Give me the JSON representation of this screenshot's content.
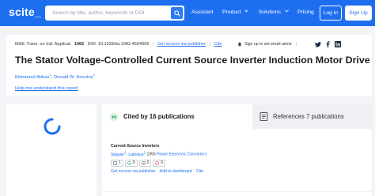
{
  "nav": {
    "logo": "scite_",
    "search_placeholder": "Search by title, author, keywords or DOI",
    "links": {
      "assistant": "Assistant",
      "product": "Product",
      "solutions": "Solutions",
      "pricing": "Pricing"
    },
    "login": "Log In",
    "signup": "Sign Up"
  },
  "paper": {
    "journal": "IEEE Trans. on Ind. Applicat.",
    "year": "1982",
    "doi": "DOI: 10.1109/tia.1982.4504065",
    "get_access": "Get access via publisher",
    "cite": "Cite",
    "alerts": "Sign up to set email alerts",
    "title": "The Stator Voltage-Controlled Current Source Inverter Induction Motor Drive",
    "authors": [
      {
        "name": "Mohamed Abbas",
        "sup": "1"
      },
      {
        "name": "Donald W. Novotny",
        "sup": "2"
      }
    ],
    "help": "Help me understand this report"
  },
  "tabs": {
    "cited_by": "Cited by 16 publications",
    "references": "References 7 publications"
  },
  "result": {
    "title": "Current-Source Inverters",
    "authors": [
      {
        "name": "Séguier",
        "sup": "1"
      },
      {
        "name": "Labrique",
        "sup": "2"
      }
    ],
    "year": "1993",
    "venue": "Power Electronic Converters",
    "counts": {
      "citing": "1",
      "supporting": "0",
      "mentioning": "0",
      "contrasting": "0"
    },
    "links": {
      "get_access": "Get access via publisher",
      "dashboard": "Add to dashboard",
      "cite": "Cite"
    }
  },
  "colors": {
    "brand": "#1e6ff0",
    "supporting": "#2fb463",
    "contrasting": "#e2465a"
  },
  "icons": {
    "search": "search-icon",
    "twitter": "twitter-icon",
    "facebook": "facebook-icon",
    "linkedin": "linkedin-icon",
    "bell": "bell-icon",
    "spinner": "loading-spinner"
  }
}
